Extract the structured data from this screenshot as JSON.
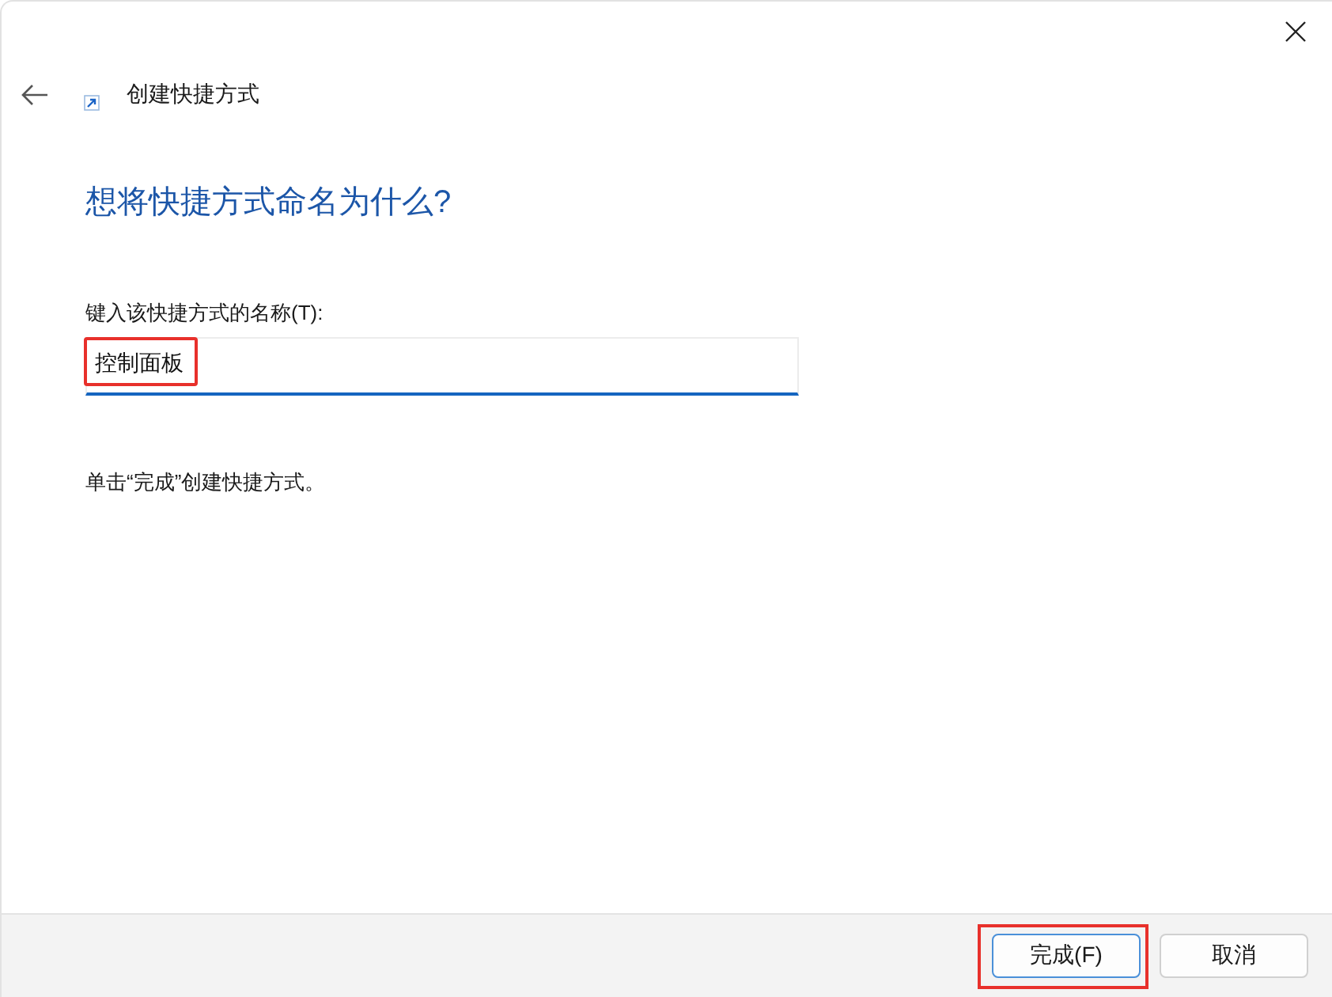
{
  "window": {
    "title": "创建快捷方式"
  },
  "heading": "想将快捷方式命名为什么?",
  "name_field": {
    "label": "键入该快捷方式的名称(T):",
    "value": "控制面板",
    "focused": true,
    "highlighted": true
  },
  "hint": "单击“完成”创建快捷方式。",
  "buttons": [
    {
      "label": "完成(F)",
      "default": true,
      "highlighted": true
    },
    {
      "label": "取消",
      "default": false,
      "highlighted": false
    }
  ]
}
